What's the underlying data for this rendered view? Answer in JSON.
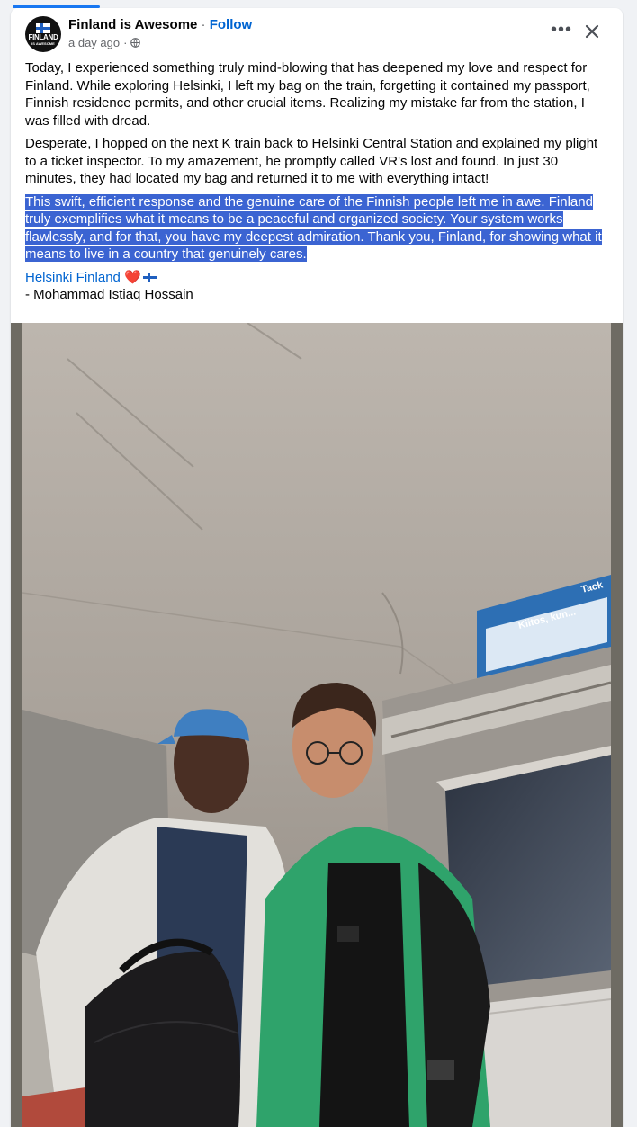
{
  "post": {
    "page_name": "Finland is Awesome",
    "separator": " · ",
    "follow_label": "Follow",
    "time": "a day ago",
    "avatar_text": "FINLAND",
    "avatar_sub": "IS AWESOME",
    "more_label": "•••",
    "icons": {
      "avatar": "finland-flag-logo",
      "privacy": "globe-icon",
      "more": "more-horizontal-icon",
      "close": "close-icon"
    },
    "colors": {
      "link": "#0064d1",
      "selection": "#3b64d2",
      "text": "#050505",
      "secondary": "#65676b"
    },
    "paragraphs": [
      "Today, I experienced something truly mind-blowing that has deepened my love and respect for Finland. While exploring Helsinki, I left my bag on the train, forgetting it contained my passport, Finnish residence permits, and other crucial items. Realizing my mistake far from the station, I was filled with dread.",
      "Desperate, I hopped on the next K train back to Helsinki Central Station and explained my plight to a ticket inspector. To my amazement, he promptly called VR's lost and found. In just 30 minutes, they had located my bag and returned it to me with everything intact!",
      "This swift, efficient response and the genuine care of the Finnish people left me in awe. Finland truly exemplifies what it means to be a peaceful and organized society. Your system works flawlessly, and for that, you have my deepest admiration. Thank you, Finland, for showing what it means to live in a country that genuinely cares."
    ],
    "hashtag": "Helsinki Finland",
    "heart": "❤️",
    "signature": "- Mohammad Istiaq Hossain",
    "photo_sign": {
      "kiitos": "Kiitos, kun...",
      "tack": "Tack"
    }
  }
}
